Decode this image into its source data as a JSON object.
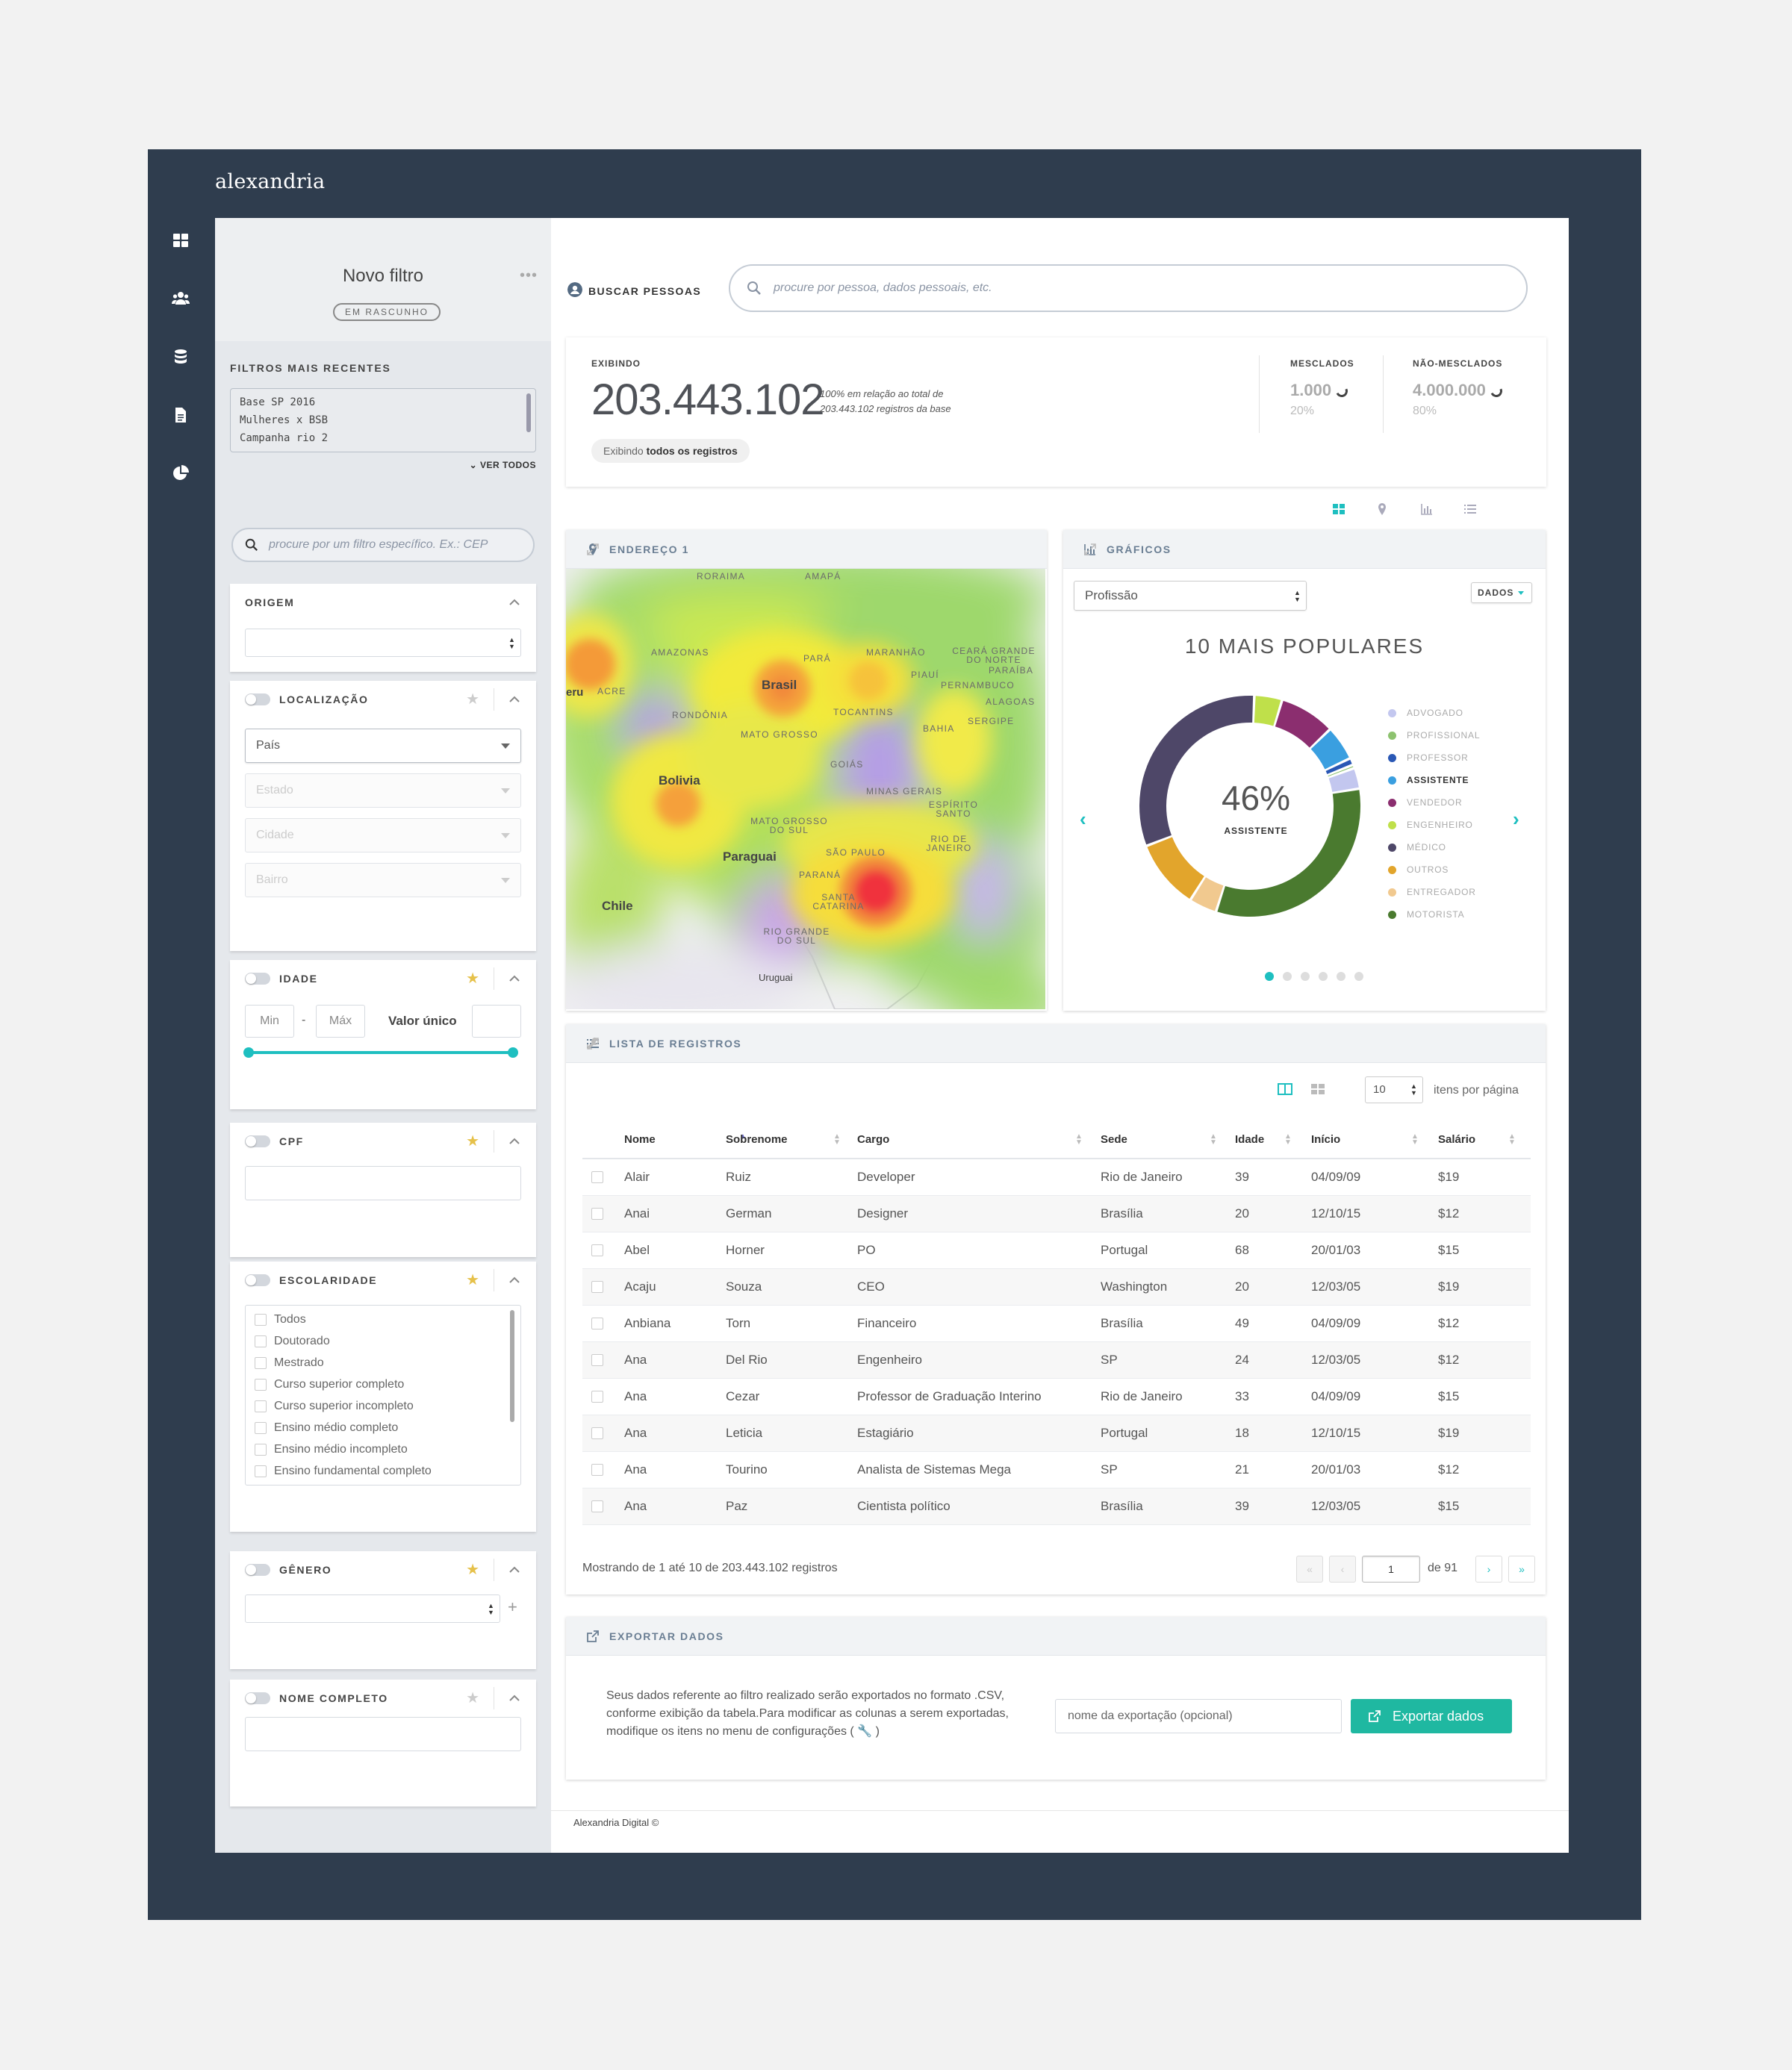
{
  "app": {
    "logo": "alexandria",
    "nav_icons": [
      "dashboard-icon",
      "users-icon",
      "database-icon",
      "document-icon",
      "pie-chart-icon"
    ]
  },
  "sidebar": {
    "title": "Novo filtro",
    "status_badge": "EM RASCUNHO",
    "recent_label": "FILTROS MAIS RECENTES",
    "recent_filters": [
      "Base SP 2016",
      "Mulheres x BSB",
      "Campanha rio 2"
    ],
    "see_all": "VER TODOS",
    "search_placeholder": "procure por um filtro específico. Ex.: CEP",
    "origem": {
      "title": "ORIGEM"
    },
    "localizacao": {
      "title": "LOCALIZAÇÃO",
      "pais": "País",
      "estado": "Estado",
      "cidade": "Cidade",
      "bairro": "Bairro"
    },
    "idade": {
      "title": "IDADE",
      "min": "Min",
      "sep": "-",
      "max": "Máx",
      "single": "Valor único",
      "range_fraction": [
        0,
        1
      ]
    },
    "cpf": {
      "title": "CPF"
    },
    "escolaridade": {
      "title": "ESCOLARIDADE",
      "options": [
        "Todos",
        "Doutorado",
        "Mestrado",
        "Curso superior completo",
        "Curso superior incompleto",
        "Ensino médio completo",
        "Ensino médio incompleto",
        "Ensino fundamental completo"
      ]
    },
    "genero": {
      "title": "GÊNERO",
      "add": "+"
    },
    "nome": {
      "title": "NOME COMPLETO"
    }
  },
  "main": {
    "search_label": "BUSCAR PESSOAS",
    "search_placeholder": "procure por pessoa, dados pessoais, etc.",
    "stats": {
      "exibindo_label": "EXIBINDO",
      "total": "203.443.102",
      "relative_line1": "100% em relação ao total de",
      "relative_line2": "203.443.102 registros da base",
      "pill_prefix": "Exibindo",
      "pill_bold": "todos os registros",
      "merged_label": "MESCLADOS",
      "merged_value": "1.000",
      "merged_pct": "20%",
      "unmerged_label": "NÃO-MESCLADOS",
      "unmerged_value": "4.000.000",
      "unmerged_pct": "80%"
    },
    "map_panel": {
      "title": "ENDEREÇO 1",
      "labels": [
        "RORAIMA",
        "AMAPÁ",
        "AMAZONAS",
        "PARÁ",
        "MARANHÃO",
        "CEARÁ GRANDE DO NORTE",
        "PIAUÍ",
        "PARAÍBA",
        "PERNAMBUCO",
        "ALAGOAS",
        "ACRE",
        "Brasil",
        "RONDÔNIA",
        "TOCANTINS",
        "SERGIPE",
        "BAHIA",
        "MATO GROSSO",
        "GOIÁS",
        "Bolivia",
        "MINAS GERAIS",
        "ESPÍRITO SANTO",
        "MATO GROSSO DO SUL",
        "RIO DE JANEIRO",
        "SÃO PAULO",
        "Paraguai",
        "PARANÁ",
        "SANTA CATARINA",
        "Chile",
        "RIO GRANDE DO SUL",
        "Uruguai",
        "eru"
      ]
    },
    "chart_panel": {
      "title": "GRÁFICOS",
      "select": "Profissão",
      "data_button": "DADOS"
    },
    "records": {
      "title": "LISTA DE REGISTROS",
      "per_page": "10",
      "per_page_label": "itens por página",
      "columns": [
        "Nome",
        "Sobrenome",
        "Cargo",
        "Sede",
        "Idade",
        "Início",
        "Salário"
      ],
      "rows": [
        [
          "Alair",
          "Ruiz",
          "Developer",
          "Rio de Janeiro",
          "39",
          "04/09/09",
          "$19"
        ],
        [
          "Anai",
          "German",
          "Designer",
          "Brasília",
          "20",
          "12/10/15",
          "$12"
        ],
        [
          "Abel",
          "Horner",
          "PO",
          "Portugal",
          "68",
          "20/01/03",
          "$15"
        ],
        [
          "Acaju",
          "Souza",
          "CEO",
          "Washington",
          "20",
          "12/03/05",
          "$19"
        ],
        [
          "Anbiana",
          "Torn",
          "Financeiro",
          "Brasília",
          "49",
          "04/09/09",
          "$12"
        ],
        [
          "Ana",
          "Del Rio",
          "Engenheiro",
          "SP",
          "24",
          "12/03/05",
          "$12"
        ],
        [
          "Ana",
          "Cezar",
          "Professor de Graduação Interino",
          "Rio de Janeiro",
          "33",
          "04/09/09",
          "$15"
        ],
        [
          "Ana",
          "Leticia",
          "Estagiário",
          "Portugal",
          "18",
          "12/10/15",
          "$19"
        ],
        [
          "Ana",
          "Tourino",
          "Analista de Sistemas Mega",
          "SP",
          "21",
          "20/01/03",
          "$12"
        ],
        [
          "Ana",
          "Paz",
          "Cientista político",
          "Brasília",
          "39",
          "12/03/05",
          "$15"
        ]
      ],
      "summary": "Mostrando de 1 até 10 de 203.443.102 registros",
      "page_first": "«",
      "page_prev": "‹",
      "page_current": "1",
      "page_of": "de 91",
      "page_next": "›",
      "page_last": "»"
    },
    "export": {
      "title": "EXPORTAR DADOS",
      "text": "Seus dados referente ao filtro realizado serão exportados no formato .CSV, conforme exibição da tabela.Para modificar as colunas a serem exportadas, modifique os itens no menu de configurações ( 🔧 )",
      "name_placeholder": "nome da exportação (opcional)",
      "button": "Exportar dados"
    },
    "footer": "Alexandria Digital ©"
  },
  "chart_data": {
    "type": "pie",
    "title": "10 MAIS POPULARES",
    "center_value": "46%",
    "center_label": "ASSISTENTE",
    "categories": [
      "ADVOGADO",
      "PROFISSIONAL",
      "PROFESSOR",
      "ASSISTENTE",
      "VENDEDOR",
      "ENGENHEIRO",
      "MÉDICO",
      "OUTROS",
      "ENTREGADOR",
      "MOTORISTA"
    ],
    "values": [
      3,
      0.5,
      1,
      5,
      8,
      4,
      31,
      10,
      4,
      32
    ],
    "colors": [
      "#c3c7ef",
      "#8dc26f",
      "#2a58b5",
      "#3a9fe0",
      "#8b2e6f",
      "#bfe04a",
      "#4e4768",
      "#e2a52c",
      "#f1c98f",
      "#4a7a2f"
    ],
    "selected": "ASSISTENTE",
    "legend_position": "right",
    "pages": 6,
    "active_page": 1
  }
}
